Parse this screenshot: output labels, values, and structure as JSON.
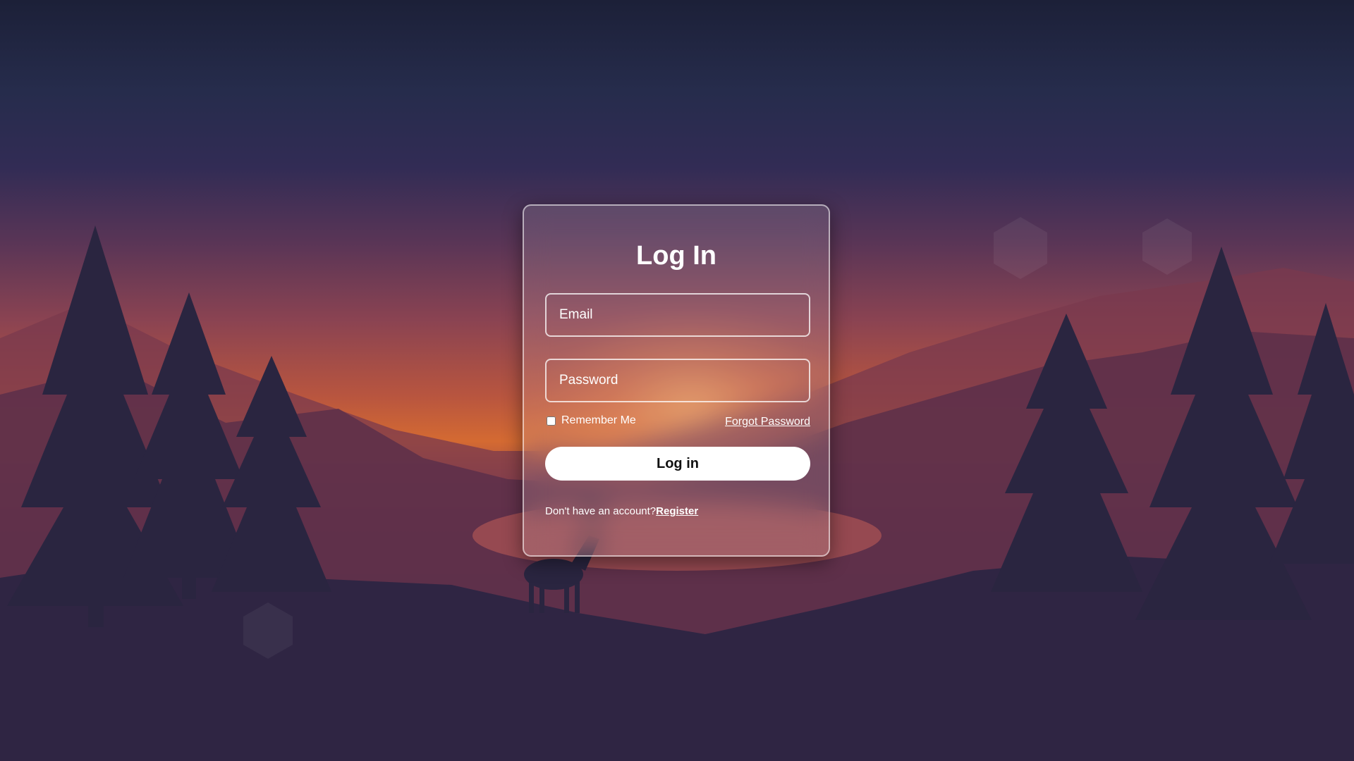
{
  "login": {
    "title": "Log In",
    "email_placeholder": "Email",
    "password_placeholder": "Password",
    "remember_label": "Remember Me",
    "forgot_label": "Forgot Password",
    "submit_label": "Log in",
    "register_prompt": "Don't have an account?",
    "register_label": "Register"
  },
  "colors": {
    "sky_top": "#1c2038",
    "horizon_orange": "#d46a32",
    "card_border": "#ffffff",
    "button_bg": "#ffffff"
  }
}
